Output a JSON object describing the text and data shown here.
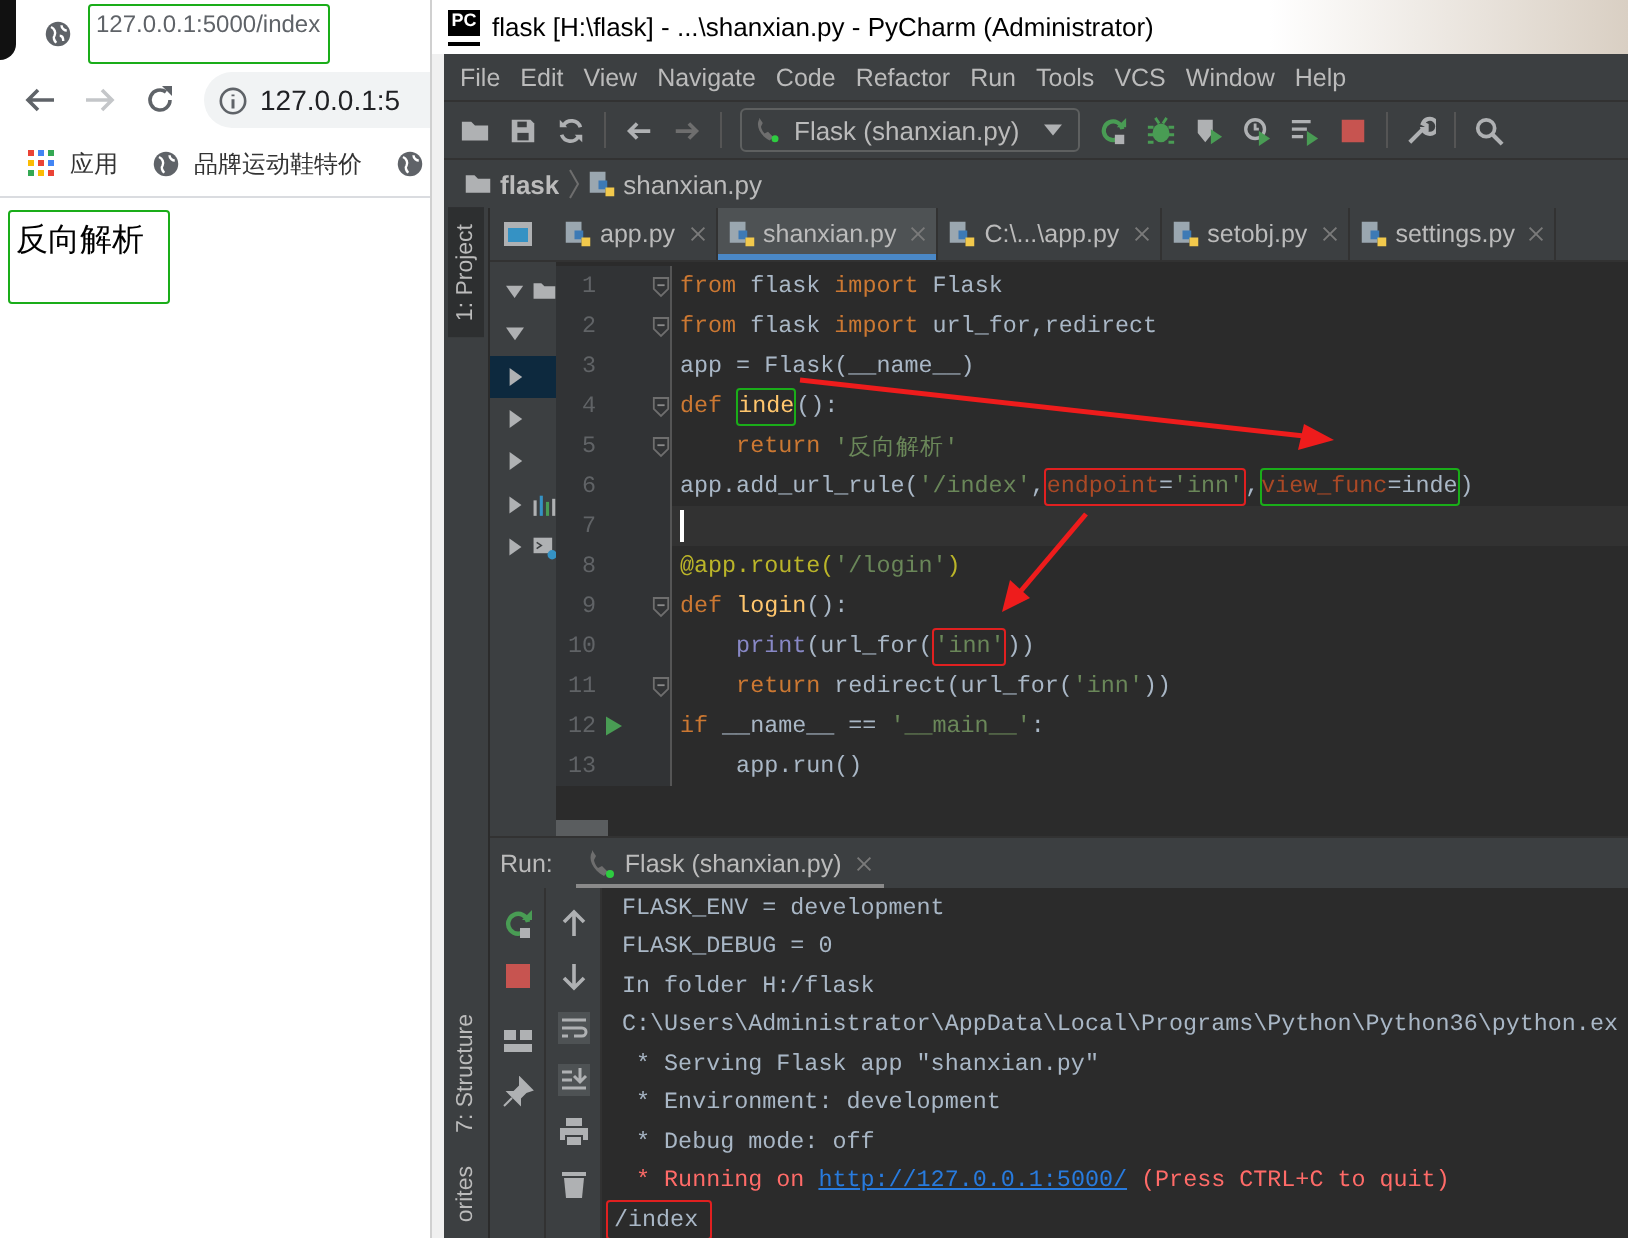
{
  "browser": {
    "tab_title": "127.0.0.1:5000/index",
    "tab_box": {
      "color": "#1aad19"
    },
    "address": "127.0.0.1:5",
    "forward_disabled": true,
    "bookmarks": [
      {
        "kind": "apps",
        "label": "应用"
      },
      {
        "kind": "site",
        "label": "品牌运动鞋特价"
      },
      {
        "kind": "site"
      }
    ],
    "page_text": "反向解析",
    "page_box": {
      "color": "#1aad19"
    }
  },
  "ide": {
    "logo": "PC",
    "title": "flask [H:\\flask] - ...\\shanxian.py - PyCharm (Administrator)",
    "menu": [
      "File",
      "Edit",
      "View",
      "Navigate",
      "Code",
      "Refactor",
      "Run",
      "Tools",
      "VCS",
      "Window",
      "Help"
    ],
    "run_config": "Flask (shanxian.py)",
    "breadcrumb": [
      "flask",
      "shanxian.py"
    ],
    "tabs": [
      {
        "label": "app.py",
        "selected": false
      },
      {
        "label": "shanxian.py",
        "selected": true
      },
      {
        "label": "C:\\...\\app.py",
        "selected": false
      },
      {
        "label": "setobj.py",
        "selected": false
      },
      {
        "label": "settings.py",
        "selected": false
      }
    ],
    "tool_windows_top": [
      {
        "label": "1: Project",
        "selected": true
      }
    ],
    "tool_windows_bottom": [
      {
        "label": "7: Structure",
        "selected": false
      },
      {
        "label": "orites",
        "selected": false
      }
    ],
    "project_tree": [
      {
        "kind": "folder",
        "expanded": true,
        "selected": false
      },
      {
        "kind": "plain",
        "expanded": true,
        "selected": false
      },
      {
        "kind": "plain",
        "expanded": false,
        "selected": true
      },
      {
        "kind": "plain",
        "expanded": false,
        "selected": false
      },
      {
        "kind": "plain",
        "expanded": false,
        "selected": false
      },
      {
        "kind": "chart",
        "expanded": false,
        "selected": false
      },
      {
        "kind": "console",
        "expanded": false,
        "selected": false
      }
    ],
    "lines": [
      {
        "number": "1",
        "fold": true,
        "run": false,
        "current": false,
        "tokens": [
          {
            "text": "from",
            "kind": "kw"
          },
          {
            "text": " flask ",
            "kind": "plain"
          },
          {
            "text": "import",
            "kind": "kw"
          },
          {
            "text": " Flask",
            "kind": "plain"
          }
        ]
      },
      {
        "number": "2",
        "fold": true,
        "run": false,
        "current": false,
        "tokens": [
          {
            "text": "from",
            "kind": "kw"
          },
          {
            "text": " flask ",
            "kind": "plain"
          },
          {
            "text": "import",
            "kind": "kw"
          },
          {
            "text": " url_for,redirect",
            "kind": "plain"
          }
        ]
      },
      {
        "number": "3",
        "fold": false,
        "run": false,
        "current": false,
        "tokens": [
          {
            "text": "app = Flask(__name__)",
            "kind": "plain"
          }
        ]
      },
      {
        "number": "4",
        "fold": true,
        "run": false,
        "current": false,
        "tokens": [
          {
            "text": "def ",
            "kind": "kw"
          },
          {
            "color": "#1aad19",
            "tokens": [
              {
                "text": "inde",
                "kind": "fn"
              }
            ]
          },
          {
            "text": "():",
            "kind": "plain"
          }
        ]
      },
      {
        "number": "5",
        "fold": true,
        "run": false,
        "current": false,
        "tokens": [
          {
            "text": "    return ",
            "kind": "kw"
          },
          {
            "text": "'反向解析'",
            "kind": "str"
          }
        ]
      },
      {
        "number": "6",
        "fold": false,
        "run": false,
        "current": false,
        "tokens": [
          {
            "text": "app.add_url_rule(",
            "kind": "plain"
          },
          {
            "text": "'/index'",
            "kind": "str"
          },
          {
            "text": ",",
            "kind": "plain"
          },
          {
            "color": "#e02020",
            "tokens": [
              {
                "text": "endpoint",
                "kind": "param"
              },
              {
                "text": "=",
                "kind": "plain"
              },
              {
                "text": "'inn'",
                "kind": "str"
              }
            ]
          },
          {
            "text": ",",
            "kind": "plain"
          },
          {
            "color": "#1aad19",
            "tokens": [
              {
                "text": "view_func",
                "kind": "param"
              },
              {
                "text": "=inde",
                "kind": "plain"
              }
            ]
          },
          {
            "text": ")",
            "kind": "plain"
          }
        ]
      },
      {
        "number": "7",
        "fold": false,
        "run": false,
        "current": true
      },
      {
        "number": "8",
        "fold": false,
        "run": false,
        "current": false,
        "tokens": [
          {
            "text": "@app.route(",
            "kind": "deco"
          },
          {
            "text": "'/login'",
            "kind": "str"
          },
          {
            "text": ")",
            "kind": "deco"
          }
        ]
      },
      {
        "number": "9",
        "fold": true,
        "run": false,
        "current": false,
        "tokens": [
          {
            "text": "def ",
            "kind": "kw"
          },
          {
            "text": "login",
            "kind": "fn"
          },
          {
            "text": "():",
            "kind": "plain"
          }
        ]
      },
      {
        "number": "10",
        "fold": false,
        "run": false,
        "current": false,
        "tokens": [
          {
            "text": "    print",
            "kind": "builtin"
          },
          {
            "text": "(url_for(",
            "kind": "plain"
          },
          {
            "color": "#e02020",
            "tokens": [
              {
                "text": "'inn'",
                "kind": "str"
              }
            ]
          },
          {
            "text": "))",
            "kind": "plain"
          }
        ]
      },
      {
        "number": "11",
        "fold": true,
        "run": false,
        "current": false,
        "tokens": [
          {
            "text": "    return",
            "kind": "kw"
          },
          {
            "text": " redirect(url_for(",
            "kind": "plain"
          },
          {
            "text": "'inn'",
            "kind": "str"
          },
          {
            "text": "))",
            "kind": "plain"
          }
        ]
      },
      {
        "number": "12",
        "fold": false,
        "run": true,
        "current": false,
        "tokens": [
          {
            "text": "if",
            "kind": "kw"
          },
          {
            "text": " __name__ == ",
            "kind": "plain"
          },
          {
            "text": "'__main__'",
            "kind": "str"
          },
          {
            "text": ":",
            "kind": "plain"
          }
        ]
      },
      {
        "number": "13",
        "fold": false,
        "run": false,
        "current": false,
        "tokens": [
          {
            "text": "    app.run()",
            "kind": "plain"
          }
        ]
      }
    ],
    "run_panel": {
      "label": "Run:",
      "tab": "Flask (shanxian.py)",
      "output": [
        {
          "segments": [
            {
              "text": "FLASK_ENV = development",
              "kind": "plain"
            }
          ]
        },
        {
          "segments": [
            {
              "text": "FLASK_DEBUG = 0",
              "kind": "plain"
            }
          ]
        },
        {
          "segments": [
            {
              "text": "In folder H:/flask",
              "kind": "plain"
            }
          ]
        },
        {
          "segments": [
            {
              "text": "C:\\Users\\Administrator\\AppData\\Local\\Programs\\Python\\Python36\\python.ex",
              "kind": "plain"
            }
          ]
        },
        {
          "segments": [
            {
              "text": " * Serving Flask app \"shanxian.py\"",
              "kind": "plain"
            }
          ]
        },
        {
          "segments": [
            {
              "text": " * Environment: development",
              "kind": "plain"
            }
          ]
        },
        {
          "segments": [
            {
              "text": " * Debug mode: off",
              "kind": "plain"
            }
          ]
        },
        {
          "segments": [
            {
              "text": " * Running on ",
              "kind": "error"
            },
            {
              "text": "http://127.0.0.1:5000/",
              "kind": "link"
            },
            {
              "text": " (Press CTRL+C to quit)",
              "kind": "error"
            }
          ]
        },
        {
          "color": "#e02020",
          "segments": [
            {
              "text": "/index",
              "kind": "plain"
            }
          ]
        }
      ]
    }
  }
}
